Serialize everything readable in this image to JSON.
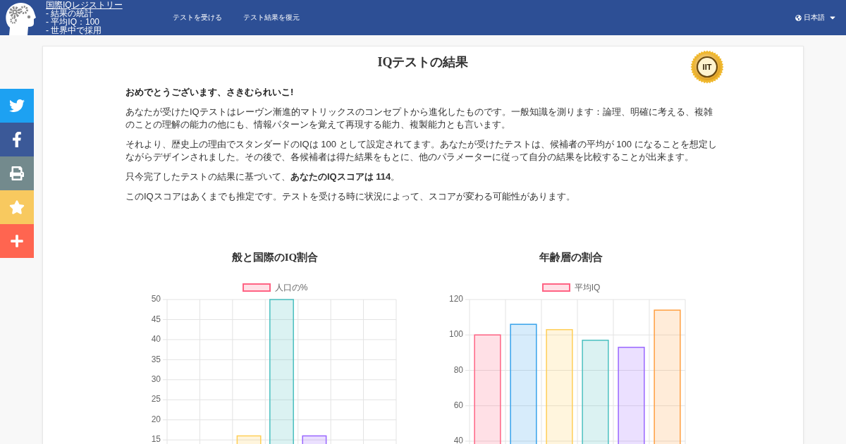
{
  "header": {
    "site_name": "国際IQレジストリー",
    "facts": [
      "- 結果の統計",
      "- 平均IQ：100",
      "- 世界中で採用"
    ],
    "nav": [
      "テストを受ける",
      "テスト結果を復元"
    ],
    "language": "日本語"
  },
  "result": {
    "title": "IQテストの結果",
    "seal": "IIT",
    "paragraphs": [
      {
        "kind": "greeting",
        "text": "おめでとうございます、さきむられいこ!"
      },
      {
        "kind": "paragraph",
        "text": "あなたが受けたIQテストはレーヴン漸進的マトリックスのコンセプトから進化したものです。一般知識を測ります：論理、明確に考える、複雑のことの理解の能力の他にも、情報パターンを覚えて再現する能力、複製能力とも言います。"
      },
      {
        "kind": "paragraph",
        "text": "それより、歴史上の理由でスタンダードのIQは 100 として設定されてます。あなたが受けたテストは、候補者の平均が 100 になることを想定しながらデザインされました。その後で、各候補者は得た結果をもとに、他のパラメーターに従って自分の結果を比較することが出来ます。"
      },
      {
        "kind": "paragraph",
        "text": "只今完了したテストの結果に基づいて、**あなたのIQスコアは 114**。"
      },
      {
        "kind": "paragraph",
        "text": "このIQスコアはあくまでも推定です。テストを受ける時に状況によって、スコアが変わる可能性があります。"
      }
    ]
  },
  "charts": [
    {
      "chart_data": {
        "type": "bar",
        "title": "般と国際のIQ割合",
        "series": [
          {
            "name": "人口の%",
            "color": [
              "#ff6384",
              null,
              "#ffce56",
              "#4bc0c0",
              "#9966ff",
              null,
              null
            ],
            "values": [
              null,
              null,
              16,
              50,
              16,
              null,
              null
            ]
          }
        ],
        "ylim": [
          13.8,
          50
        ],
        "yticks": [
          15,
          20,
          25,
          30,
          35,
          40,
          45,
          50
        ],
        "grid": true
      }
    },
    {
      "chart_data": {
        "type": "bar",
        "title": "年齢層の割合",
        "series": [
          {
            "name": "平均IQ",
            "color": [
              "#ff6384",
              "#36a2eb",
              "#ffce56",
              "#4bc0c0",
              "#9966ff",
              "#ff9f40"
            ],
            "values": [
              100,
              106,
              103,
              97,
              93,
              114
            ]
          }
        ],
        "ylim": [
          38,
          120
        ],
        "yticks": [
          40,
          60,
          80,
          100,
          120
        ],
        "grid": true
      }
    }
  ]
}
